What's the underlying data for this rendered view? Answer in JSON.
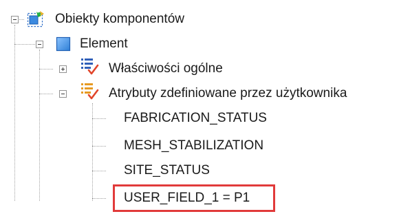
{
  "tree": {
    "root": {
      "label": "Obiekty komponentów",
      "icon": "component-objects-icon",
      "expanded": true
    },
    "element": {
      "label": "Element",
      "icon": "element-square-icon",
      "expanded": true
    },
    "general_properties": {
      "label": "Właściwości ogólne",
      "icon": "properties-checklist-icon",
      "expanded": false
    },
    "user_attributes": {
      "label": "Atrybuty zdefiniowane przez użytkownika",
      "icon": "user-attributes-checklist-icon",
      "expanded": true
    },
    "attributes": [
      "FABRICATION_STATUS",
      "MESH_STABILIZATION",
      "SITE_STATUS",
      "USER_FIELD_1 = P1"
    ],
    "highlighted_attribute_index": 3
  },
  "colors": {
    "highlight": "#e13a3a",
    "tree_lines": "#a0a0a0",
    "element_icon": "#3b8ae0"
  }
}
